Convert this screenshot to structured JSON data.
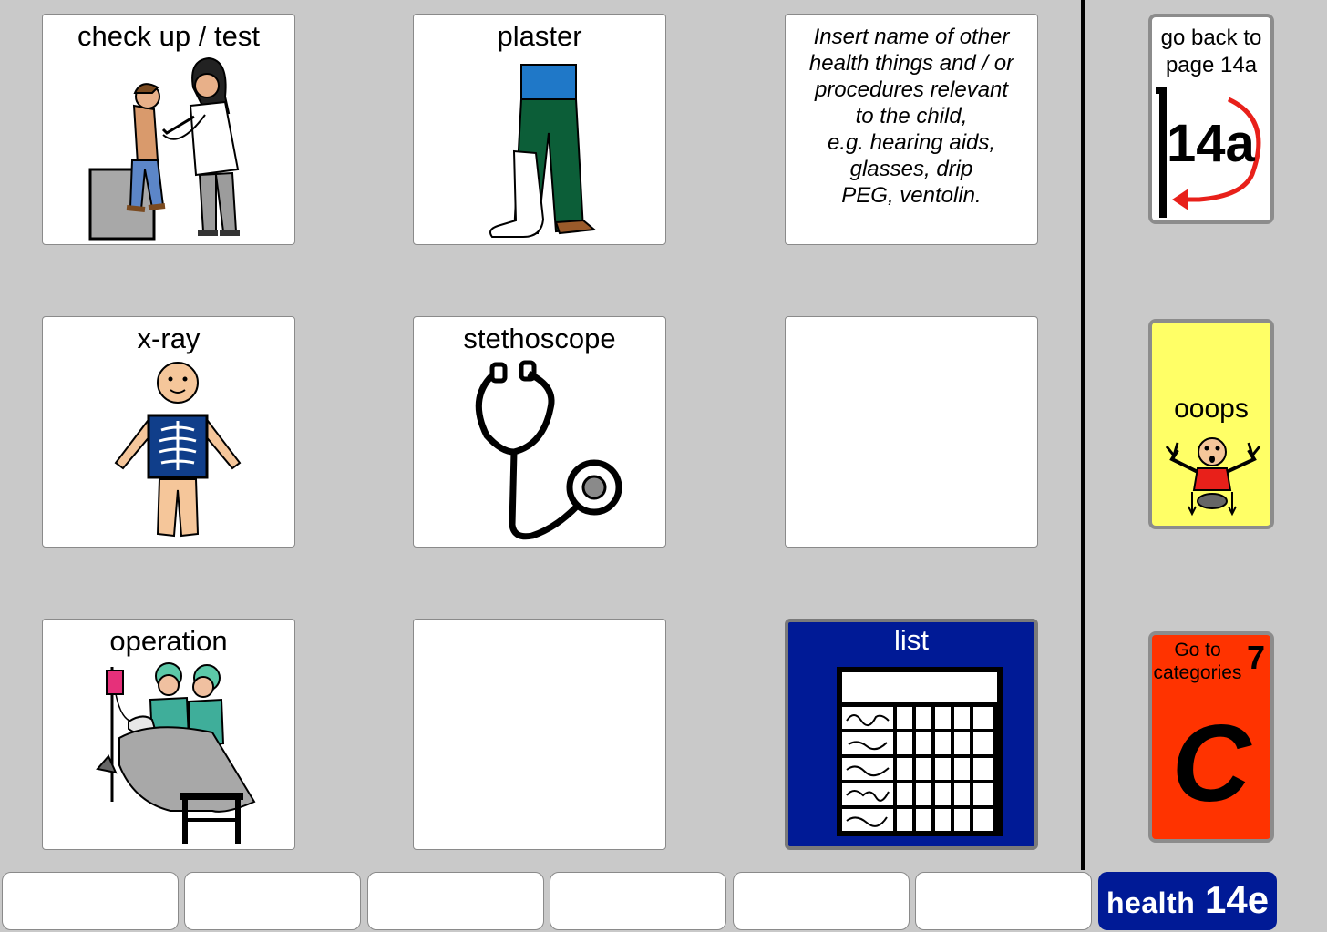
{
  "grid": {
    "cells": [
      {
        "label": "check up / test"
      },
      {
        "label": "plaster"
      },
      {
        "note_lines": [
          "Insert name of other",
          "health things and / or",
          "procedures relevant",
          "to the child,",
          "e.g. hearing aids,",
          "glasses, drip",
          "PEG, ventolin."
        ]
      },
      {
        "label": "x-ray"
      },
      {
        "label": "stethoscope"
      },
      {
        "label": ""
      },
      {
        "label": "operation"
      },
      {
        "label": ""
      },
      {
        "label": "list"
      }
    ]
  },
  "sidebar": {
    "back": {
      "line1": "go back to",
      "line2": "page 14a",
      "icon_text": "14a"
    },
    "oops": {
      "label": "ooops"
    },
    "categories": {
      "line1": "Go to",
      "line2": "categories",
      "number": "7",
      "letter": "C"
    }
  },
  "footer": {
    "page_name": "health",
    "page_number": "14e"
  },
  "colors": {
    "background": "#c9c9c9",
    "list_bg": "#001a96",
    "oops_bg": "#ffff66",
    "categories_bg": "#ff3300",
    "page_tag_bg": "#001a96"
  },
  "icons": [
    "doctor-checkup-icon",
    "plaster-cast-icon",
    "xray-icon",
    "stethoscope-icon",
    "operation-icon",
    "list-table-icon",
    "go-back-arrow-icon",
    "oops-person-icon"
  ]
}
